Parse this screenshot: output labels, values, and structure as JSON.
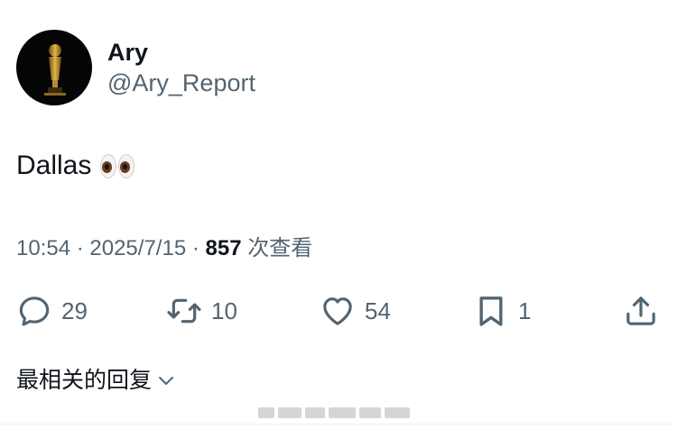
{
  "author": {
    "display_name": "Ary",
    "handle": "@Ary_Report",
    "avatar_icon": "trophy-icon"
  },
  "tweet": {
    "text": "Dallas",
    "emoji": "eyes-emoji"
  },
  "meta": {
    "time": "10:54",
    "separator": " · ",
    "date": "2025/7/15",
    "views_count": "857",
    "views_label": " 次查看"
  },
  "actions": {
    "replies": "29",
    "retweets": "10",
    "likes": "54",
    "bookmarks": "1"
  },
  "replies_sort": {
    "label": "最相关的回复"
  },
  "colors": {
    "text_primary": "#0f1419",
    "text_secondary": "#536471",
    "background": "#ffffff"
  }
}
